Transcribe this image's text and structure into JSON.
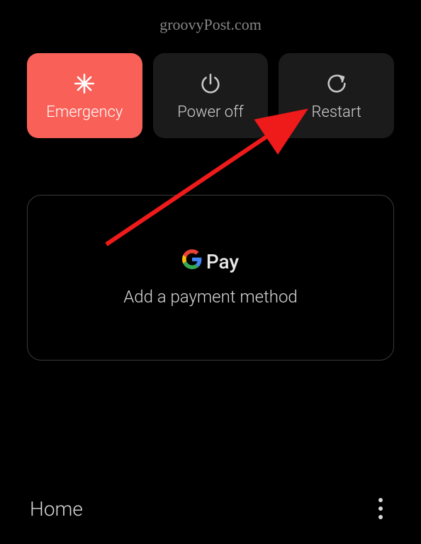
{
  "watermark": "groovyPost.com",
  "powerMenu": {
    "emergency": "Emergency",
    "powerOff": "Power off",
    "restart": "Restart"
  },
  "paymentCard": {
    "logoText": "Pay",
    "subtitle": "Add a payment method"
  },
  "bottomBar": {
    "home": "Home"
  }
}
